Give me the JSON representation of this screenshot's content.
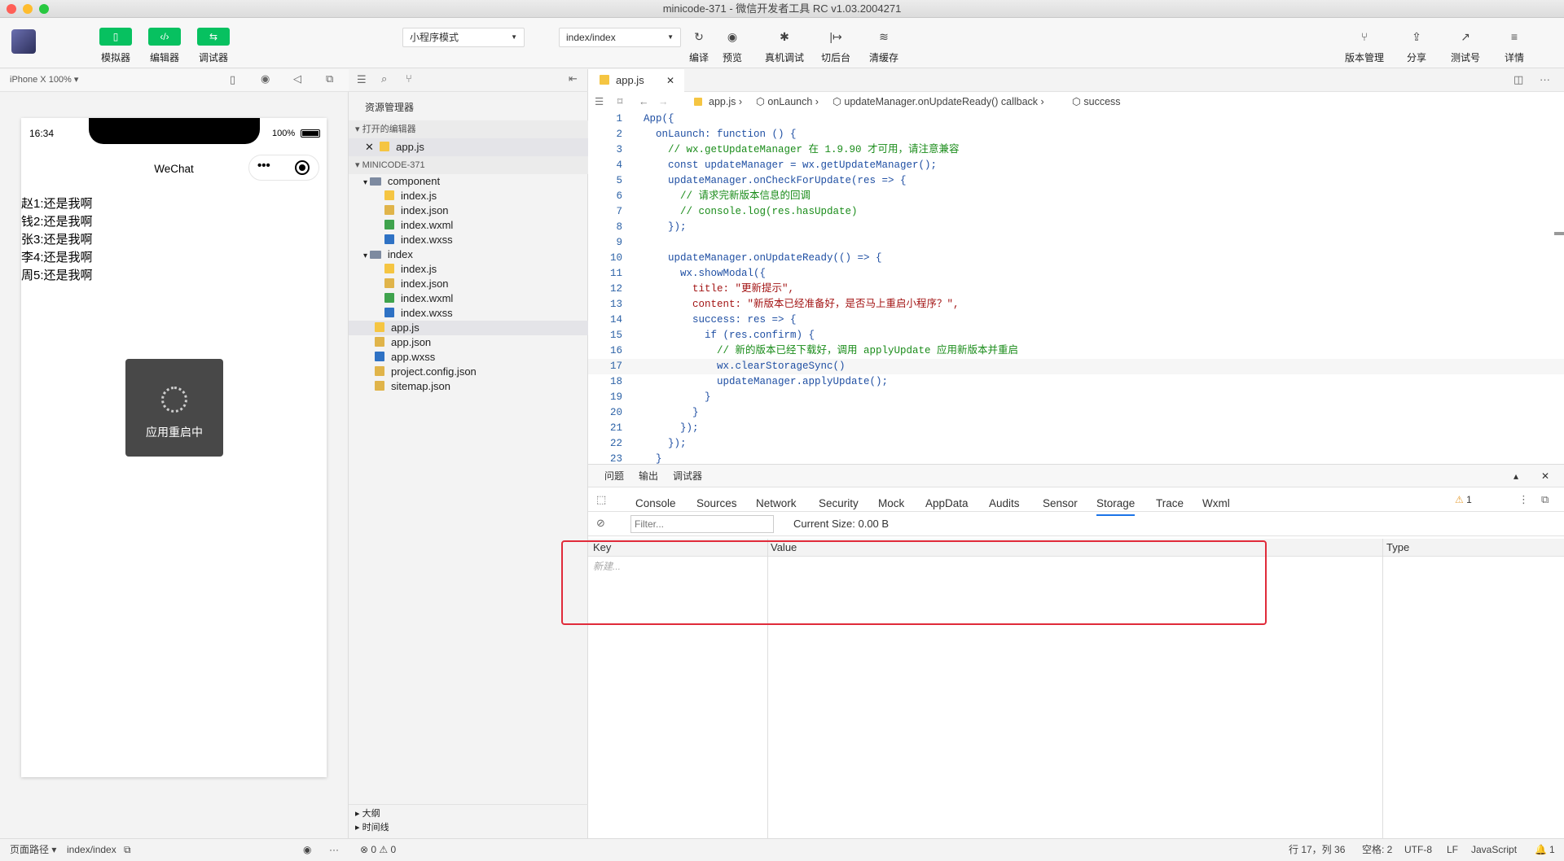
{
  "window": {
    "title": "minicode-371 - 微信开发者工具 RC v1.03.2004271"
  },
  "toolbar": {
    "simulator_label": "模拟器",
    "editor_label": "编辑器",
    "debugger_label": "调试器",
    "mode_select": "小程序模式",
    "page_select": "index/index",
    "compile_label": "编译",
    "preview_label": "预览",
    "real_debug_label": "真机调试",
    "background_label": "切后台",
    "clear_cache_label": "清缓存",
    "version_label": "版本管理",
    "share_label": "分享",
    "test_label": "测试号",
    "details_label": "详情"
  },
  "simulator": {
    "device": "iPhone X 100% ▾",
    "time": "16:34",
    "battery": "100%",
    "nav_title": "WeChat",
    "lines": [
      "赵1:还是我啊",
      "钱2:还是我啊",
      "张3:还是我啊",
      "李4:还是我啊",
      "周5:还是我啊"
    ],
    "toast": "应用重启中"
  },
  "explorer": {
    "title": "资源管理器",
    "open_editors": "打开的编辑器",
    "open_file": "app.js",
    "project": "MINICODE-371",
    "tree": [
      {
        "name": "component",
        "type": "folder",
        "depth": 1
      },
      {
        "name": "index.js",
        "type": "js",
        "depth": 2
      },
      {
        "name": "index.json",
        "type": "json",
        "depth": 2
      },
      {
        "name": "index.wxml",
        "type": "wxml",
        "depth": 2
      },
      {
        "name": "index.wxss",
        "type": "wxss",
        "depth": 2
      },
      {
        "name": "index",
        "type": "folder",
        "depth": 1
      },
      {
        "name": "index.js",
        "type": "js",
        "depth": 2
      },
      {
        "name": "index.json",
        "type": "json",
        "depth": 2
      },
      {
        "name": "index.wxml",
        "type": "wxml",
        "depth": 2
      },
      {
        "name": "index.wxss",
        "type": "wxss",
        "depth": 2
      },
      {
        "name": "app.js",
        "type": "js",
        "depth": 1
      },
      {
        "name": "app.json",
        "type": "json",
        "depth": 1
      },
      {
        "name": "app.wxss",
        "type": "wxss",
        "depth": 1
      },
      {
        "name": "project.config.json",
        "type": "json",
        "depth": 1
      },
      {
        "name": "sitemap.json",
        "type": "json",
        "depth": 1
      }
    ],
    "outline": "大纲",
    "timeline": "时间线"
  },
  "editor": {
    "tab": "app.js",
    "breadcrumb": [
      "app.js",
      "onLaunch",
      "updateManager.onUpdateReady() callback",
      "success"
    ],
    "lines": [
      "App({",
      "  onLaunch: function () {",
      "    // wx.getUpdateManager 在 1.9.90 才可用，请注意兼容",
      "    const updateManager = wx.getUpdateManager();",
      "    updateManager.onCheckForUpdate(res => {",
      "      // 请求完新版本信息的回调",
      "      // console.log(res.hasUpdate)",
      "    });",
      "",
      "    updateManager.onUpdateReady(() => {",
      "      wx.showModal({",
      "        title: \"更新提示\",",
      "        content: \"新版本已经准备好，是否马上重启小程序？\",",
      "        success: res => {",
      "          if (res.confirm) {",
      "            // 新的版本已经下载好，调用 applyUpdate 应用新版本并重启",
      "            wx.clearStorageSync()",
      "            updateManager.applyUpdate();",
      "          }",
      "        }",
      "      });",
      "    });",
      "  }"
    ]
  },
  "devtools": {
    "top_tabs": [
      "问题",
      "输出",
      "调试器"
    ],
    "tabs": [
      "Console",
      "Sources",
      "Network",
      "Security",
      "Mock",
      "AppData",
      "Audits",
      "Sensor",
      "Storage",
      "Trace",
      "Wxml"
    ],
    "active_tab": "Storage",
    "warning_count": "1",
    "filter_placeholder": "Filter...",
    "current_size": "Current Size:  0.00 B",
    "col_key": "Key",
    "col_value": "Value",
    "col_type": "Type",
    "new_placeholder": "新建..."
  },
  "status": {
    "page_path_label": "页面路径 ▾",
    "page_path": "index/index",
    "errors": "⊗ 0 ⚠ 0",
    "cursor": "行 17，列 36",
    "spaces": "空格: 2",
    "encoding": "UTF-8",
    "eol": "LF",
    "language": "JavaScript",
    "notifications": "1"
  }
}
